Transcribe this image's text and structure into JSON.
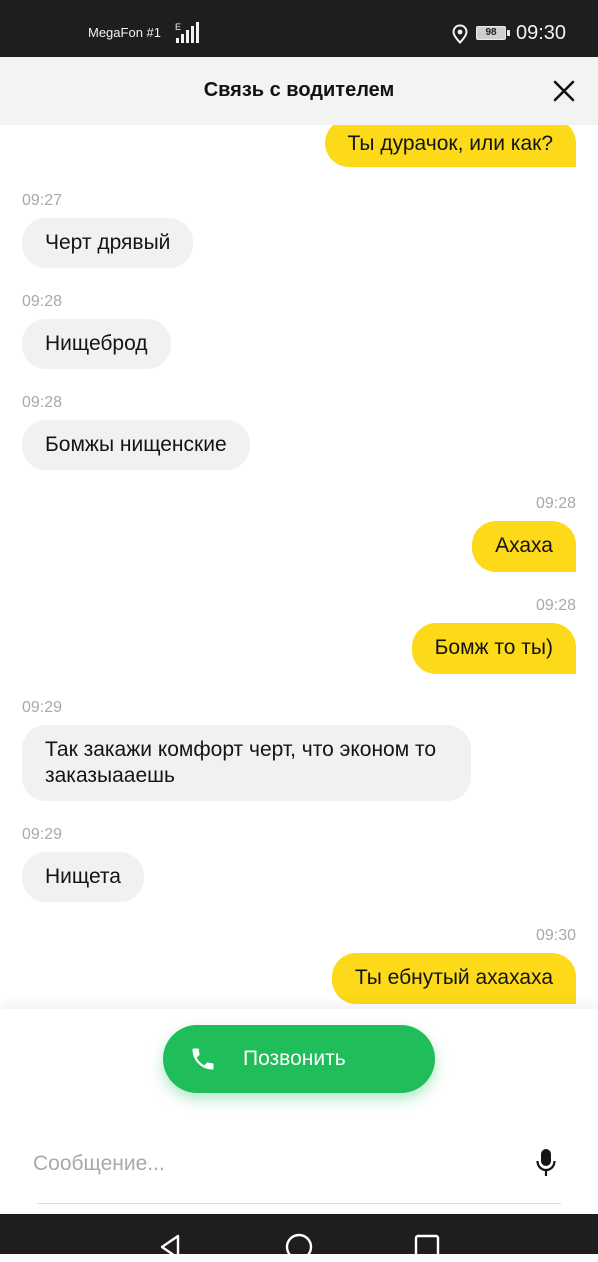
{
  "status_bar": {
    "carrier": "MegaFon #1",
    "network_type": "E",
    "battery": "98",
    "time": "09:30"
  },
  "header": {
    "title": "Связь с водителем"
  },
  "messages": [
    {
      "direction": "outgoing",
      "text": "Ты дурачок, или как?",
      "time": ""
    },
    {
      "direction": "incoming",
      "text": "Черт дрявый",
      "time": "09:27"
    },
    {
      "direction": "incoming",
      "text": "Нищеброд",
      "time": "09:28"
    },
    {
      "direction": "incoming",
      "text": "Бомжы нищенские",
      "time": "09:28"
    },
    {
      "direction": "outgoing",
      "text": "Ахаха",
      "time": "09:28"
    },
    {
      "direction": "outgoing",
      "text": "Бомж то ты)",
      "time": "09:28"
    },
    {
      "direction": "incoming",
      "text": "Так закажи комфорт черт, что эконом то заказыааешь",
      "time": "09:29"
    },
    {
      "direction": "incoming",
      "text": "Нищета",
      "time": "09:29"
    },
    {
      "direction": "outgoing",
      "text": "Ты ебнутый ахахаха",
      "time": "09:30"
    }
  ],
  "call_button": {
    "label": "Позвонить",
    "icon": "phone-icon",
    "color": "#20be5a"
  },
  "input": {
    "placeholder": "Сообщение...",
    "value": ""
  },
  "colors": {
    "outgoing_bubble": "#fcd919",
    "incoming_bubble": "#f2f1ef",
    "header_bg": "#f3f3f2",
    "timestamp": "#a9a9a9"
  }
}
